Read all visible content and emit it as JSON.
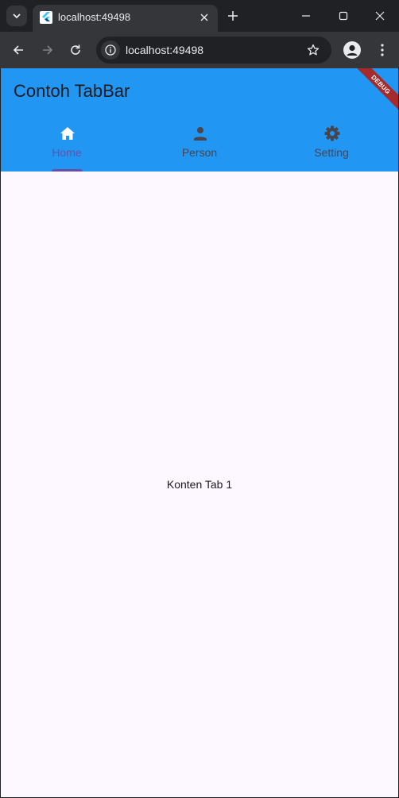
{
  "browser": {
    "tab": {
      "title": "localhost:49498"
    },
    "address": {
      "url": "localhost:49498"
    }
  },
  "app": {
    "title": "Contoh TabBar",
    "tabs": [
      {
        "label": "Home",
        "icon": "home-icon",
        "selected": true
      },
      {
        "label": "Person",
        "icon": "person-icon",
        "selected": false
      },
      {
        "label": "Setting",
        "icon": "settings-icon",
        "selected": false
      }
    ],
    "content": "Konten Tab 1",
    "debug_banner": "DEBUG"
  },
  "colors": {
    "appbar": "#2196f3",
    "accent": "#6750a4",
    "background": "#fdf7ff",
    "debug_banner": "#a52a2a"
  }
}
